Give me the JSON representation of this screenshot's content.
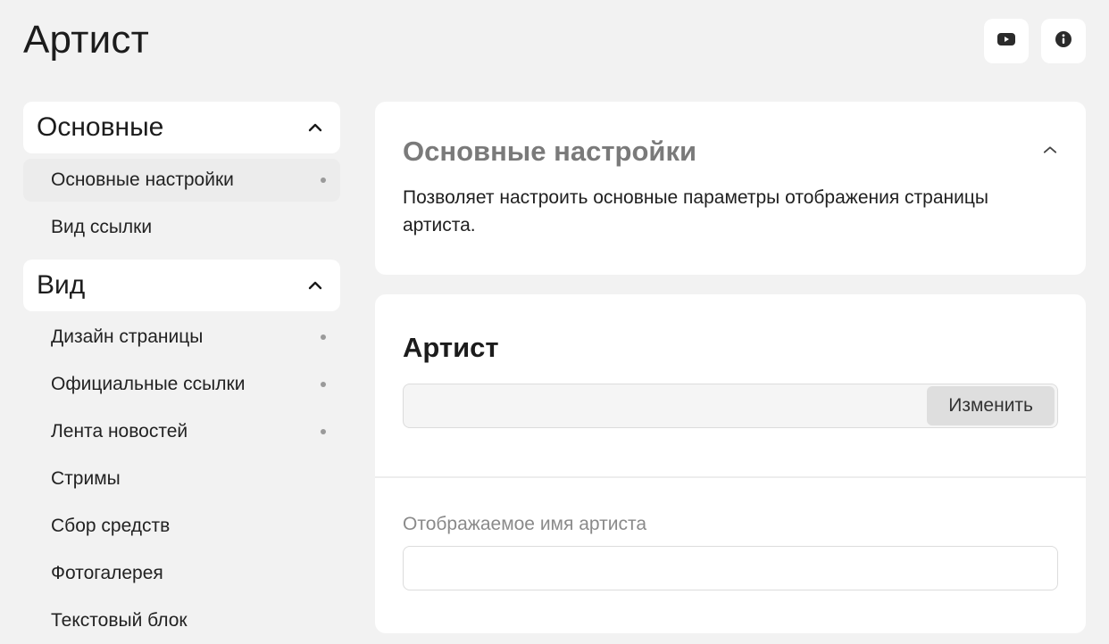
{
  "page": {
    "title": "Артист"
  },
  "toolbar": {
    "video_icon": "video-icon",
    "info_icon": "info-icon"
  },
  "sidebar": {
    "groups": [
      {
        "title": "Основные",
        "items": [
          {
            "label": "Основные настройки",
            "active": true,
            "dot": true
          },
          {
            "label": "Вид ссылки",
            "active": false,
            "dot": false
          }
        ]
      },
      {
        "title": "Вид",
        "items": [
          {
            "label": "Дизайн страницы",
            "active": false,
            "dot": true
          },
          {
            "label": "Официальные ссылки",
            "active": false,
            "dot": true
          },
          {
            "label": "Лента новостей",
            "active": false,
            "dot": true
          },
          {
            "label": "Стримы",
            "active": false,
            "dot": false
          },
          {
            "label": "Сбор средств",
            "active": false,
            "dot": false
          },
          {
            "label": "Фотогалерея",
            "active": false,
            "dot": false
          },
          {
            "label": "Текстовый блок",
            "active": false,
            "dot": false
          }
        ]
      }
    ]
  },
  "main": {
    "info_card": {
      "title": "Основные настройки",
      "description": "Позволяет настроить основные параметры отображения страницы артиста."
    },
    "artist_card": {
      "title": "Артист",
      "artist_value": "",
      "change_label": "Изменить",
      "display_name_label": "Отображаемое имя артиста",
      "display_name_value": "",
      "display_name_placeholder": ""
    }
  },
  "colors": {
    "background": "#f2f2f2",
    "card": "#ffffff",
    "active_item": "#ececec",
    "button": "#dedede"
  }
}
